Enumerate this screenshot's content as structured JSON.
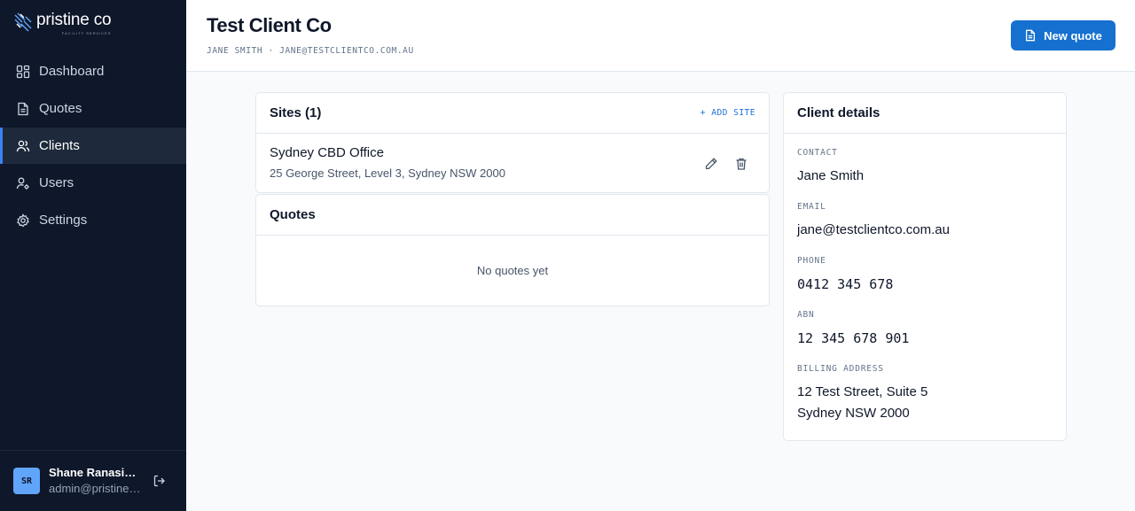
{
  "brand": {
    "name": "pristine co",
    "tagline": "FACILITY SERVICES",
    "icon": "brand-logo"
  },
  "sidebar": {
    "items": [
      {
        "label": "Dashboard",
        "icon": "dashboard-icon",
        "active": false
      },
      {
        "label": "Quotes",
        "icon": "document-icon",
        "active": false
      },
      {
        "label": "Clients",
        "icon": "users-icon",
        "active": true
      },
      {
        "label": "Users",
        "icon": "user-cog-icon",
        "active": false
      },
      {
        "label": "Settings",
        "icon": "gear-icon",
        "active": false
      }
    ]
  },
  "user": {
    "initials": "SR",
    "name": "Shane Ranasinghe",
    "email": "admin@pristineco.com.au",
    "logout_icon": "logout-icon"
  },
  "header": {
    "title": "Test Client Co",
    "subtitle": "JANE SMITH · JANE@TESTCLIENTCO.COM.AU",
    "new_quote_label": "New quote"
  },
  "sites": {
    "title": "Sites (1)",
    "add_label": "+ ADD SITE",
    "items": [
      {
        "name": "Sydney CBD Office",
        "address": "25 George Street, Level 3, Sydney NSW 2000"
      }
    ]
  },
  "quotes": {
    "title": "Quotes",
    "empty": "No quotes yet"
  },
  "details": {
    "title": "Client details",
    "contact_label": "CONTACT",
    "contact": "Jane Smith",
    "email_label": "EMAIL",
    "email": "jane@testclientco.com.au",
    "phone_label": "PHONE",
    "phone": "0412 345 678",
    "abn_label": "ABN",
    "abn": "12 345 678 901",
    "billing_label": "BILLING ADDRESS",
    "billing_line1": "12 Test Street, Suite 5",
    "billing_line2": "Sydney NSW 2000"
  },
  "colors": {
    "sidebar": "#0f172a",
    "accent": "#1570d0",
    "active_bar": "#3b82f6"
  }
}
